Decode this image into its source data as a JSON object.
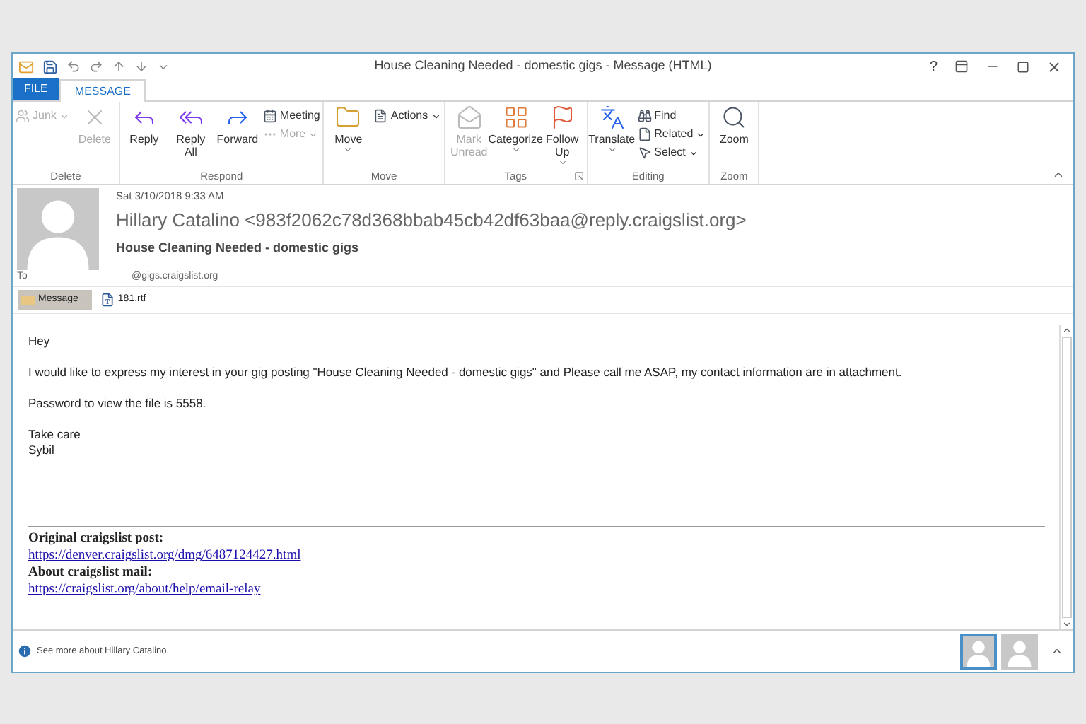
{
  "window": {
    "title": "House Cleaning Needed - domestic gigs - Message (HTML)",
    "help": "?"
  },
  "tabs": [
    {
      "label": "FILE",
      "kind": "file",
      "selected": false
    },
    {
      "label": "MESSAGE",
      "kind": "tab",
      "selected": true
    }
  ],
  "ribbon": [
    {
      "label": "Delete",
      "launcher": false,
      "columns": [
        {
          "kind": "stack",
          "items": [
            {
              "label": "Junk",
              "disabled": true,
              "dropdown": true
            }
          ]
        },
        {
          "kind": "large",
          "label": "Delete",
          "disabled": true,
          "dropdown": false
        }
      ]
    },
    {
      "label": "Respond",
      "launcher": false,
      "columns": [
        {
          "kind": "large",
          "label": "Reply",
          "disabled": false,
          "dropdown": false
        },
        {
          "kind": "large",
          "label": "Reply All",
          "disabled": false,
          "dropdown": false
        },
        {
          "kind": "large",
          "label": "Forward",
          "disabled": false,
          "dropdown": false
        },
        {
          "kind": "stack",
          "items": [
            {
              "label": "Meeting",
              "disabled": false,
              "dropdown": false
            },
            {
              "label": "More",
              "disabled": true,
              "dropdown": true
            }
          ]
        }
      ]
    },
    {
      "label": "Move",
      "launcher": false,
      "columns": [
        {
          "kind": "large",
          "label": "Move",
          "disabled": false,
          "dropdown": true
        },
        {
          "kind": "stack",
          "items": [
            {
              "label": "Actions",
              "disabled": false,
              "dropdown": true
            }
          ]
        }
      ]
    },
    {
      "label": "Tags",
      "launcher": true,
      "columns": [
        {
          "kind": "large",
          "label": "Mark Unread",
          "disabled": true,
          "dropdown": false
        },
        {
          "kind": "large",
          "label": "Categorize",
          "disabled": false,
          "dropdown": true
        },
        {
          "kind": "large",
          "label": "Follow Up",
          "disabled": false,
          "dropdown": true
        }
      ]
    },
    {
      "label": "Editing",
      "launcher": false,
      "columns": [
        {
          "kind": "large",
          "label": "Translate",
          "disabled": false,
          "dropdown": true
        },
        {
          "kind": "stack",
          "items": [
            {
              "label": "Find",
              "disabled": false,
              "dropdown": false
            },
            {
              "label": "Related",
              "disabled": false,
              "dropdown": true
            },
            {
              "label": "Select",
              "disabled": false,
              "dropdown": true
            }
          ]
        }
      ]
    },
    {
      "label": "Zoom",
      "launcher": false,
      "columns": [
        {
          "kind": "large",
          "label": "Zoom",
          "disabled": false,
          "dropdown": false
        }
      ]
    }
  ],
  "header": {
    "date": "Sat 3/10/2018 9:33 AM",
    "sender": "Hillary Catalino <983f2062c78d368bbab45cb42df63baa@reply.craigslist.org>",
    "subject": "House Cleaning Needed - domestic gigs",
    "to_label": "To",
    "to": "@gigs.craigslist.org"
  },
  "attachments": [
    {
      "label": "Message",
      "kind": "message",
      "selected": true
    },
    {
      "label": "181.rtf",
      "kind": "file",
      "selected": false
    }
  ],
  "body": {
    "paragraphs": [
      [
        "Hey"
      ],
      [
        "I would like to express my interest in your gig posting \"House Cleaning Needed - domestic gigs\" and Please call me ASAP, my contact information are in attachment."
      ],
      [
        "Password to view the file is 5558."
      ],
      [
        "Take care",
        "Sybil"
      ]
    ],
    "footer_lines": [
      {
        "kind": "bold",
        "text": "Original craigslist post:"
      },
      {
        "kind": "link",
        "text": "https://denver.craigslist.org/dmg/6487124427.html"
      },
      {
        "kind": "bold",
        "text": "About craigslist mail:"
      },
      {
        "kind": "link",
        "text": "https://craigslist.org/about/help/email-relay"
      }
    ]
  },
  "people_pane": {
    "text": "See more about Hillary Catalino.",
    "avatars": [
      {
        "selected": true
      },
      {
        "selected": false
      }
    ]
  }
}
